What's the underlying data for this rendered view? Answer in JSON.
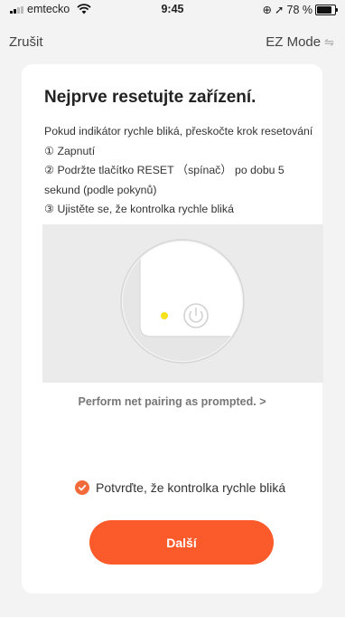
{
  "status_bar": {
    "carrier": "emtecko",
    "time": "9:45",
    "battery": "78 %",
    "signal_bars": 2
  },
  "nav": {
    "cancel_label": "Zrušit",
    "mode_label": "EZ Mode",
    "mode_icon": "swap-arrows-icon"
  },
  "card": {
    "title": "Nejprve resetujte zařízení.",
    "instructions": [
      "Pokud indikátor rychle bliká, přeskočte krok resetování",
      "① Zapnutí",
      "② Podržte tlačítko RESET （spínač） po dobu 5",
      "sekund (podle pokynů)",
      "③ Ujistěte se, že kontrolka rychle bliká"
    ],
    "illustration": {
      "indicator_color": "#f7e01c",
      "icon": "power-icon"
    },
    "pairing_link": "Perform net pairing as prompted. >",
    "confirm_label": "Potvrďte, že kontrolka rychle bliká",
    "confirm_checked": true,
    "next_label": "Další"
  },
  "colors": {
    "accent": "#fb5a2a",
    "checkbox": "#f36a3a",
    "background": "#f3f3f3"
  }
}
